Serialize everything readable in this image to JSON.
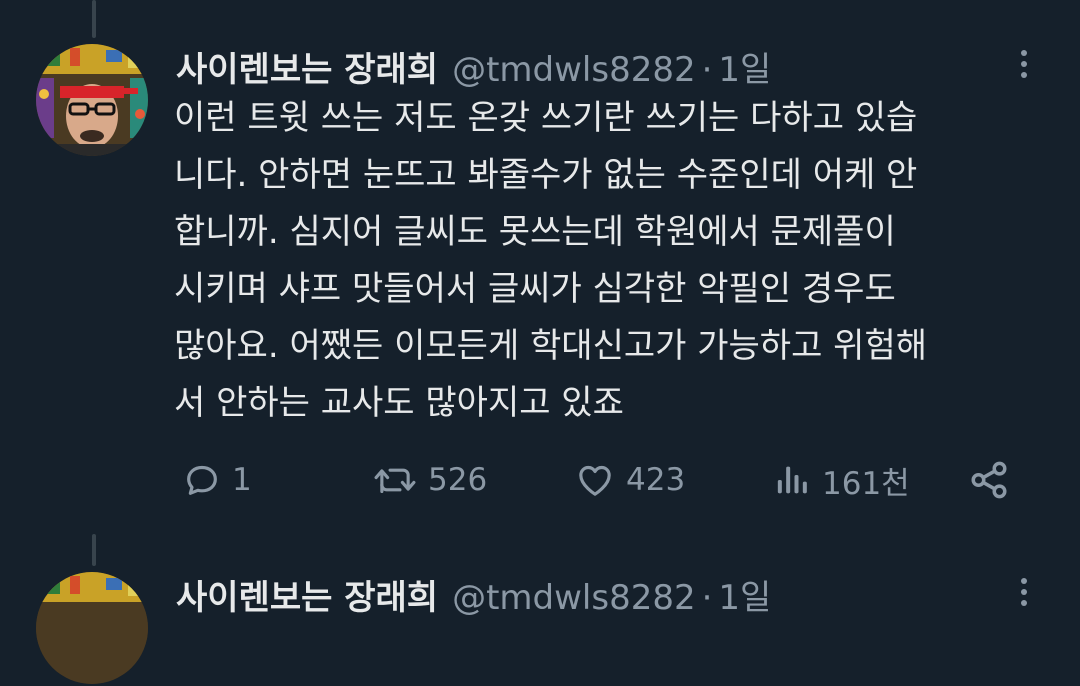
{
  "tweets": [
    {
      "display_name": "사이렌보는 장래희",
      "handle": "@tmdwls8282",
      "separator": "·",
      "time": "1일",
      "body_lines": [
        "이런 트윗 쓰는 저도 온갖 쓰기란 쓰기는 다하고 있습",
        "니다. 안하면 눈뜨고 봐줄수가 없는 수준인데 어케 안",
        "합니까. 심지어 글씨도 못쓰는데 학원에서 문제풀이",
        "시키며 샤프 맛들어서 글씨가 심각한 악필인 경우도",
        "많아요. 어쨌든 이모든게 학대신고가 가능하고 위험해",
        "서 안하는 교사도 많아지고 있죠"
      ],
      "actions": {
        "reply": {
          "icon": "reply-icon",
          "count": "1"
        },
        "retweet": {
          "icon": "retweet-icon",
          "count": "526"
        },
        "like": {
          "icon": "heart-icon",
          "count": "423"
        },
        "views": {
          "icon": "views-icon",
          "count": "161천"
        },
        "share": {
          "icon": "share-icon"
        }
      }
    },
    {
      "display_name": "사이렌보는 장래희",
      "handle": "@tmdwls8282",
      "separator": "·",
      "time": "1일"
    }
  ],
  "colors": {
    "background": "#15202b",
    "text_primary": "#e7e9ea",
    "text_secondary": "#8b98a5",
    "thread_line": "#38444d"
  }
}
